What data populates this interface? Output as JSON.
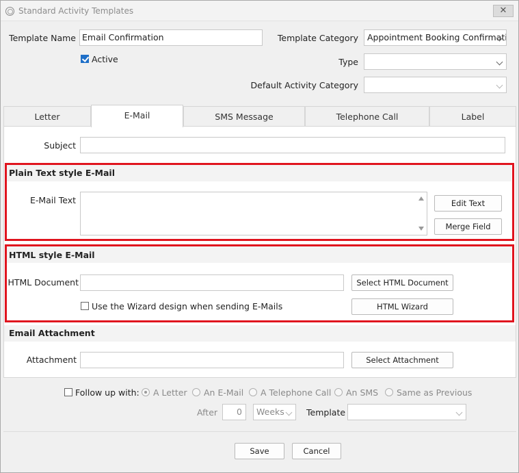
{
  "window": {
    "title": "Standard Activity Templates",
    "close_glyph": "✕"
  },
  "header": {
    "template_name_label": "Template Name",
    "template_name_value": "Email Confirmation",
    "active_label": "Active",
    "active_checked": true,
    "template_category_label": "Template Category",
    "template_category_value": "Appointment Booking Confirmation",
    "type_label": "Type",
    "type_value": "",
    "default_activity_category_label": "Default Activity Category",
    "default_activity_category_value": ""
  },
  "tabs": [
    {
      "label": "Letter",
      "active": false
    },
    {
      "label": "E-Mail",
      "active": true
    },
    {
      "label": "SMS Message",
      "active": false
    },
    {
      "label": "Telephone Call",
      "active": false
    },
    {
      "label": "Label",
      "active": false
    }
  ],
  "email_tab": {
    "subject_label": "Subject",
    "subject_value": "",
    "plain_section_title": "Plain Text style E-Mail",
    "email_text_label": "E-Mail Text",
    "email_text_value": "",
    "edit_text_button": "Edit Text",
    "merge_field_button": "Merge Field",
    "html_section_title": "HTML style E-Mail",
    "html_document_label": "HTML Document",
    "html_document_value": "",
    "select_html_button": "Select HTML Document",
    "wizard_checkbox_label": "Use the Wizard design when sending E-Mails",
    "html_wizard_button": "HTML Wizard",
    "attachment_section_title": "Email Attachment",
    "attachment_label": "Attachment",
    "attachment_value": "",
    "select_attachment_button": "Select Attachment"
  },
  "follow_up": {
    "checkbox_label": "Follow up with:",
    "options": [
      "A Letter",
      "An E-Mail",
      "A Telephone Call",
      "An SMS",
      "Same as Previous"
    ],
    "selected_option": "A Letter",
    "after_label": "After",
    "after_value": "0",
    "unit_value": "Weeks",
    "template_label": "Template",
    "template_value": ""
  },
  "footer": {
    "save_button": "Save",
    "cancel_button": "Cancel"
  },
  "colors": {
    "highlight_border": "#e0141e",
    "checkbox_accent": "#1e6fc8"
  }
}
